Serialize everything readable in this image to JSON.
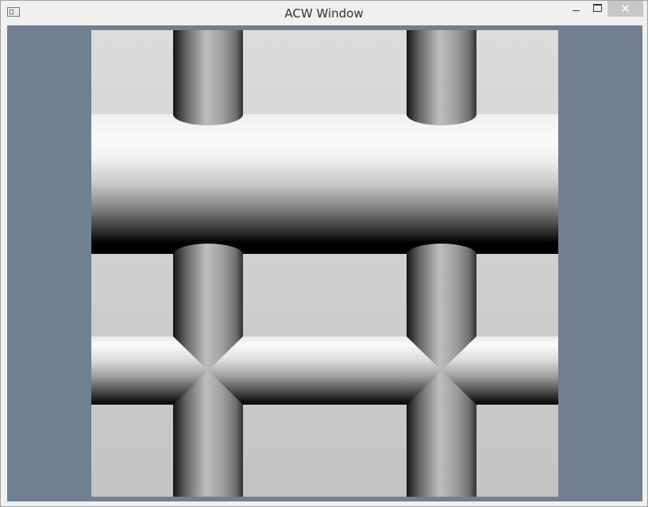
{
  "window": {
    "title": "ACW Window",
    "close_glyph": "✕"
  },
  "icons": {
    "app": "app-window-icon",
    "minimize": "minimize-icon",
    "maximize": "maximize-icon",
    "close": "close-icon"
  },
  "colors": {
    "client_background": "#708090",
    "close_button": "#c7c7c7"
  }
}
